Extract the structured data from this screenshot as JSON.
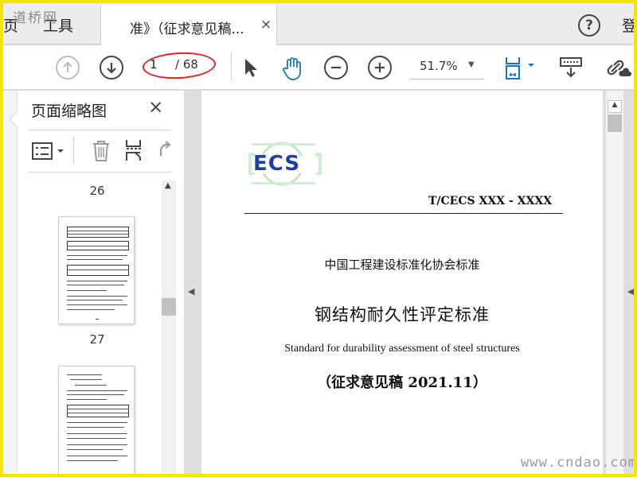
{
  "tabbar": {
    "home_fragment": "页",
    "tools_tab": "工具",
    "active_tab_title": "准》（征求意见稿...",
    "close_glyph": "×",
    "help_glyph": "?",
    "right_edge_fragment": "登"
  },
  "watermarks": {
    "top_left": "道桥网",
    "bottom_right": "www.cndao.com"
  },
  "toolbar": {
    "current_page": "1",
    "total_pages": "/ 68",
    "zoom": "51.7%",
    "annotation_color": "#e02525",
    "accent_color": "#1a73c9"
  },
  "thumbnail_panel": {
    "title": "页面缩略图",
    "close_glyph": "×",
    "page_labels": [
      "26",
      "27"
    ]
  },
  "document": {
    "logo_text": "ECS",
    "standard_code": "T/CECS    XXX - XXXX",
    "organization": "中国工程建设标准化协会标准",
    "title": "钢结构耐久性评定标准",
    "subtitle": "Standard for durability assessment of steel structures",
    "draft_label": "（征求意见稿 2021.11）"
  }
}
